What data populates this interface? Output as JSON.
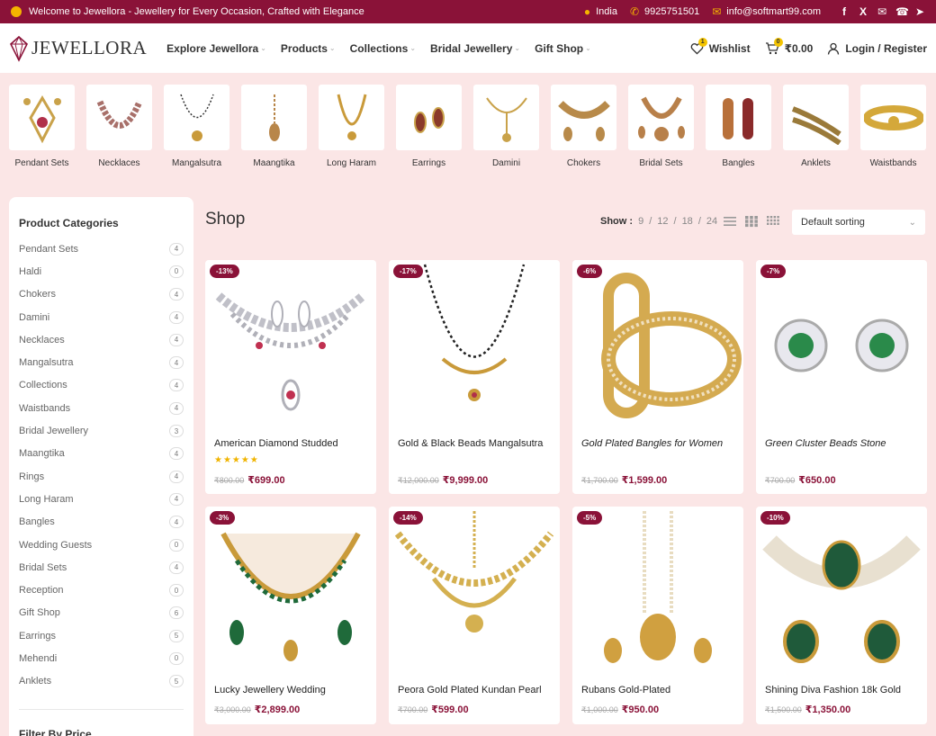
{
  "topbar": {
    "welcome": "Welcome to Jewellora - Jewellery for Every Occasion, Crafted with Elegance",
    "location": "India",
    "phone": "9925751501",
    "email": "info@softmart99.com",
    "social": [
      "facebook-icon",
      "x-icon",
      "mail-icon",
      "whatsapp-icon",
      "telegram-icon"
    ]
  },
  "header": {
    "logo": "JEWELLORA",
    "nav": [
      "Explore Jewellora",
      "Products",
      "Collections",
      "Bridal Jewellery",
      "Gift Shop"
    ],
    "wishlist_label": "Wishlist",
    "wishlist_count": "1",
    "cart_count": "0",
    "cart_total": "₹0.00",
    "login_label": "Login / Register"
  },
  "categories": [
    {
      "label": "Pendant Sets",
      "color": "#c9a24a"
    },
    {
      "label": "Necklaces",
      "color": "#a8706a"
    },
    {
      "label": "Mangalsutra",
      "color": "#c99a3a"
    },
    {
      "label": "Maangtika",
      "color": "#b8864a"
    },
    {
      "label": "Long Haram",
      "color": "#c99a3a"
    },
    {
      "label": "Earrings",
      "color": "#8a3a2a"
    },
    {
      "label": "Damini",
      "color": "#c9a24a"
    },
    {
      "label": "Chokers",
      "color": "#b88a4a"
    },
    {
      "label": "Bridal Sets",
      "color": "#b8804a"
    },
    {
      "label": "Bangles",
      "color": "#b8703a"
    },
    {
      "label": "Anklets",
      "color": "#9a7a3a"
    },
    {
      "label": "Waistbands",
      "color": "#d4a83a"
    }
  ],
  "sidebar": {
    "title": "Product Categories",
    "items": [
      {
        "label": "Pendant Sets",
        "count": "4"
      },
      {
        "label": "Haldi",
        "count": "0"
      },
      {
        "label": "Chokers",
        "count": "4"
      },
      {
        "label": "Damini",
        "count": "4"
      },
      {
        "label": "Necklaces",
        "count": "4"
      },
      {
        "label": "Mangalsutra",
        "count": "4"
      },
      {
        "label": "Collections",
        "count": "4"
      },
      {
        "label": "Waistbands",
        "count": "4"
      },
      {
        "label": "Bridal Jewellery",
        "count": "3"
      },
      {
        "label": "Maangtika",
        "count": "4"
      },
      {
        "label": "Rings",
        "count": "4"
      },
      {
        "label": "Long Haram",
        "count": "4"
      },
      {
        "label": "Bangles",
        "count": "4"
      },
      {
        "label": "Wedding Guests",
        "count": "0"
      },
      {
        "label": "Bridal Sets",
        "count": "4"
      },
      {
        "label": "Reception",
        "count": "0"
      },
      {
        "label": "Gift Shop",
        "count": "6"
      },
      {
        "label": "Earrings",
        "count": "5"
      },
      {
        "label": "Mehendi",
        "count": "0"
      },
      {
        "label": "Anklets",
        "count": "5"
      }
    ],
    "filter_title": "Filter By Price"
  },
  "shop": {
    "title": "Shop",
    "show_label": "Show :",
    "show_options": [
      "9",
      "12",
      "18",
      "24"
    ],
    "sort_label": "Default sorting"
  },
  "products": [
    {
      "name": "American Diamond Studded",
      "discount": "-13%",
      "old": "₹800.00",
      "new": "₹699.00",
      "stars": "★★★★★",
      "italic": false,
      "color": "#c0c0c8"
    },
    {
      "name": "Gold & Black Beads Mangalsutra",
      "discount": "-17%",
      "old": "₹12,000.00",
      "new": "₹9,999.00",
      "stars": "",
      "italic": false,
      "color": "#c99a3a"
    },
    {
      "name": "Gold Plated Bangles for Women",
      "discount": "-6%",
      "old": "₹1,700.00",
      "new": "₹1,599.00",
      "stars": "",
      "italic": true,
      "color": "#d4aa50"
    },
    {
      "name": "Green Cluster Beads Stone",
      "discount": "-7%",
      "old": "₹700.00",
      "new": "₹650.00",
      "stars": "",
      "italic": true,
      "color": "#2a8a4a"
    },
    {
      "name": "Lucky Jewellery Wedding",
      "discount": "-3%",
      "old": "₹3,000.00",
      "new": "₹2,899.00",
      "stars": "",
      "italic": false,
      "color": "#1f6a3a"
    },
    {
      "name": "Peora Gold Plated Kundan Pearl",
      "discount": "-14%",
      "old": "₹700.00",
      "new": "₹599.00",
      "stars": "",
      "italic": false,
      "color": "#d4b050"
    },
    {
      "name": "Rubans Gold-Plated",
      "discount": "-5%",
      "old": "₹1,000.00",
      "new": "₹950.00",
      "stars": "",
      "italic": false,
      "color": "#d0a040"
    },
    {
      "name": "Shining Diva Fashion 18k Gold",
      "discount": "-10%",
      "old": "₹1,500.00",
      "new": "₹1,350.00",
      "stars": "",
      "italic": false,
      "color": "#1f5a3a"
    }
  ]
}
